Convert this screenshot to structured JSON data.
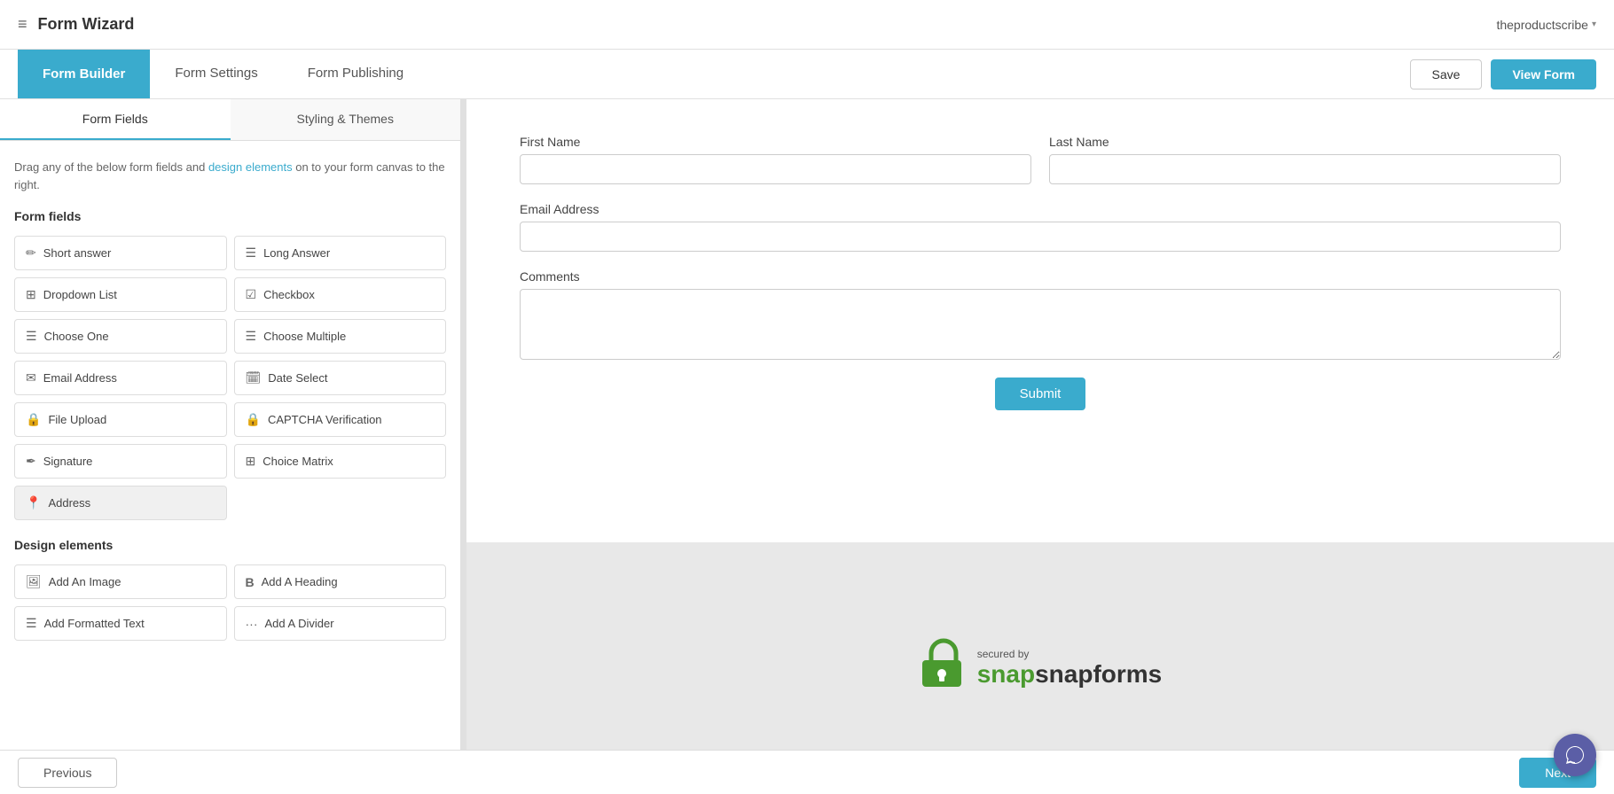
{
  "app": {
    "title": "Form Wizard",
    "user": "theproductscribe",
    "dropdown_arrow": "▾"
  },
  "nav": {
    "tabs": [
      {
        "id": "form-builder",
        "label": "Form Builder",
        "active": true
      },
      {
        "id": "form-settings",
        "label": "Form Settings",
        "active": false
      },
      {
        "id": "form-publishing",
        "label": "Form Publishing",
        "active": false
      }
    ],
    "save_label": "Save",
    "view_form_label": "View Form"
  },
  "left_panel": {
    "tabs": [
      {
        "id": "form-fields",
        "label": "Form Fields",
        "active": true
      },
      {
        "id": "styling-themes",
        "label": "Styling & Themes",
        "active": false
      }
    ],
    "description": "Drag any of the below form fields and design elements on to your form canvas to the right.",
    "description_highlight": "design elements",
    "form_fields_title": "Form fields",
    "fields": [
      {
        "id": "short-answer",
        "label": "Short answer",
        "icon": "✏"
      },
      {
        "id": "long-answer",
        "label": "Long Answer",
        "icon": "☰"
      },
      {
        "id": "dropdown-list",
        "label": "Dropdown List",
        "icon": "⊞"
      },
      {
        "id": "checkbox",
        "label": "Checkbox",
        "icon": "☑"
      },
      {
        "id": "choose-one",
        "label": "Choose One",
        "icon": "☰"
      },
      {
        "id": "choose-multiple",
        "label": "Choose Multiple",
        "icon": "☰"
      },
      {
        "id": "email-address",
        "label": "Email Address",
        "icon": "✉"
      },
      {
        "id": "date-select",
        "label": "Date Select",
        "icon": "📅"
      },
      {
        "id": "file-upload",
        "label": "File Upload",
        "icon": "🔒"
      },
      {
        "id": "captcha",
        "label": "CAPTCHA Verification",
        "icon": "🔒"
      },
      {
        "id": "signature",
        "label": "Signature",
        "icon": "✒"
      },
      {
        "id": "choice-matrix",
        "label": "Choice Matrix",
        "icon": "⊞"
      },
      {
        "id": "address",
        "label": "Address",
        "icon": "📍"
      }
    ],
    "design_elements_title": "Design elements",
    "design_elements": [
      {
        "id": "add-image",
        "label": "Add An Image",
        "icon": "🖼"
      },
      {
        "id": "add-heading",
        "label": "Add A Heading",
        "icon": "B"
      },
      {
        "id": "add-formatted-text",
        "label": "Add Formatted Text",
        "icon": "☰"
      },
      {
        "id": "add-divider",
        "label": "Add A Divider",
        "icon": "···"
      }
    ]
  },
  "form": {
    "fields": [
      {
        "id": "first-name",
        "label": "First Name",
        "type": "text",
        "placeholder": ""
      },
      {
        "id": "last-name",
        "label": "Last Name",
        "type": "text",
        "placeholder": ""
      },
      {
        "id": "email-address",
        "label": "Email Address",
        "type": "email",
        "placeholder": ""
      },
      {
        "id": "comments",
        "label": "Comments",
        "type": "textarea",
        "placeholder": ""
      }
    ],
    "submit_label": "Submit"
  },
  "footer": {
    "secured_by": "secured by",
    "brand": "snapforms",
    "lock_icon": "🔒"
  },
  "bottom": {
    "prev_label": "Previous",
    "next_label": "Next"
  },
  "icons": {
    "hamburger": "≡",
    "chat": "💬"
  }
}
